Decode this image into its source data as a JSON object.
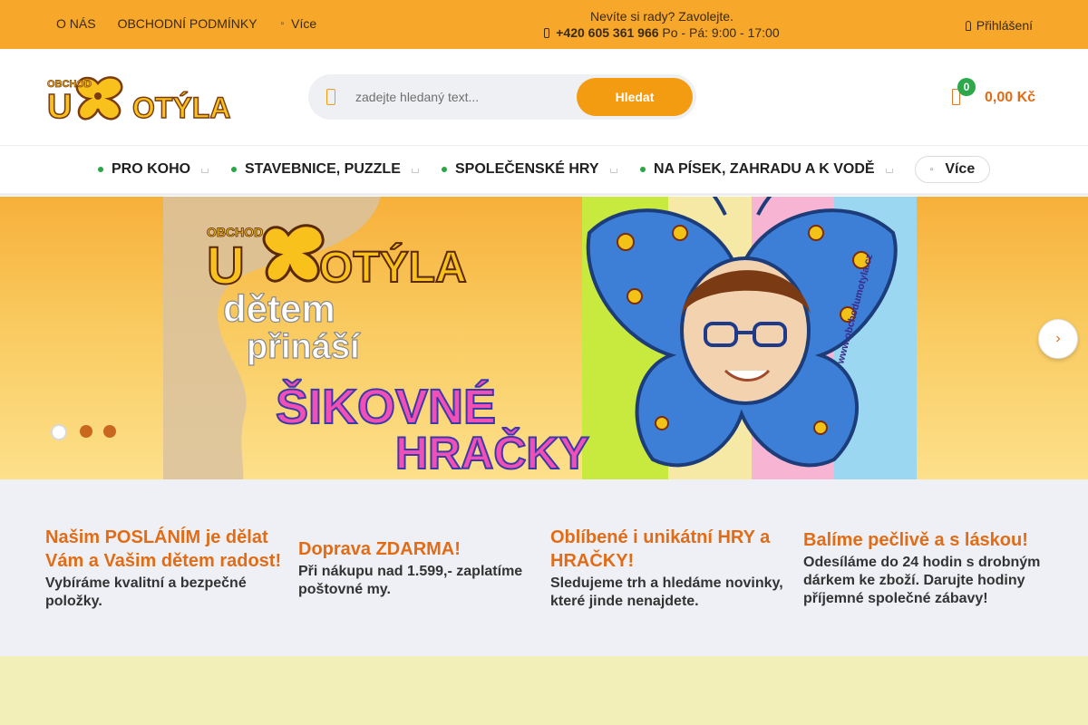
{
  "topbar": {
    "nav": [
      "O NÁS",
      "OBCHODNÍ PODMÍNKY"
    ],
    "more_label": "Více",
    "contact_line1": "Nevíte si rady? Zavolejte.",
    "phone": "+420 605 361 966",
    "hours": "Po - Pá: 9:00 - 17:00",
    "login_label": "Přihlášení"
  },
  "logo": {
    "small_text": "OBCHOD",
    "main_text": "U MOTÝLA"
  },
  "search": {
    "placeholder": "zadejte hledaný text...",
    "value": "",
    "button_label": "Hledat"
  },
  "cart": {
    "count": "0",
    "total": "0,00 Kč"
  },
  "categories": [
    "PRO KOHO",
    "STAVEBNICE, PUZZLE",
    "SPOLEČENSKÉ HRY",
    "NA PÍSEK, ZAHRADU A K VODĚ"
  ],
  "categories_more": "Více",
  "banner": {
    "small_text": "OBCHOD",
    "brand": "U MOTÝLA",
    "line1": "dětem",
    "line2": "přináší",
    "line3": "ŠIKOVNÉ",
    "line4": "HRAČKY",
    "url_text": "www.obchodumotyla.cz",
    "slides": 3,
    "active_slide": 1
  },
  "features": [
    {
      "title": "Našim POSLÁNÍM je dělat Vám a Vašim dětem radost!",
      "text": "Vybíráme kvalitní a bezpečné položky."
    },
    {
      "title": "Doprava ZDARMA!",
      "text": "Při nákupu nad 1.599,- zaplatíme poštovné my."
    },
    {
      "title": "Oblíbené i unikátní HRY a HRAČKY!",
      "text": "Sledujeme trh a hledáme novinky, které jinde nenajdete."
    },
    {
      "title": "Balíme pečlivě a s láskou!",
      "text": "Odesíláme do 24 hodin s drobným dárkem ke zboží. Darujte hodiny příjemné společné zábavy!"
    }
  ],
  "colors": {
    "topbar": "#f7a72a",
    "accent": "#f39c12",
    "price": "#e26c16",
    "bullet": "#28a745",
    "features_bg": "#eef0f5"
  },
  "icons": {
    "more": "dots-icon",
    "phone": "phone-icon",
    "login": "user-icon",
    "search": "search-icon",
    "cart": "cart-icon",
    "next": "chevron-right-icon"
  }
}
